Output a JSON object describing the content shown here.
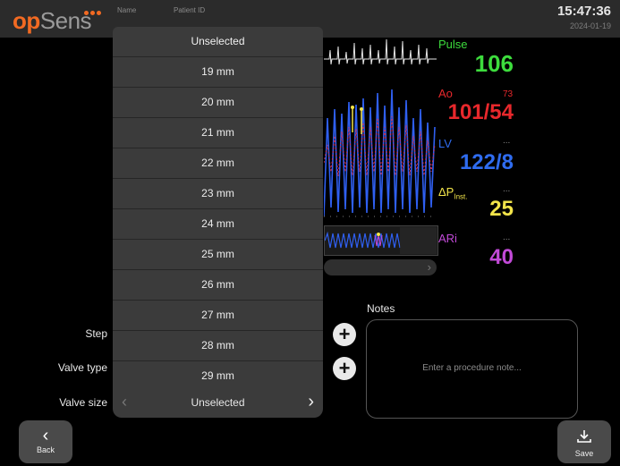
{
  "header": {
    "logo_op": "op",
    "logo_sens": "Sens",
    "name_label": "Name",
    "patient_id_label": "Patient ID",
    "time": "15:47:36",
    "date": "2024-01-19"
  },
  "vitals": {
    "pulse": {
      "label": "Pulse",
      "value": "106",
      "color": "#3ddc3d"
    },
    "ao": {
      "label": "Ao",
      "small": "73",
      "value": "101/54",
      "color": "#e8282c"
    },
    "lv": {
      "label": "LV",
      "small": "...",
      "value": "122/8",
      "color": "#2f6cf0"
    },
    "dp": {
      "label": "ΔP",
      "sub": "Inst.",
      "small": "...",
      "value": "25",
      "color": "#f2e44a"
    },
    "ari": {
      "label": "ARi",
      "small": "...",
      "value": "40",
      "color": "#c24ad8"
    }
  },
  "dropdown": {
    "items": [
      "Unselected",
      "19 mm",
      "20 mm",
      "21 mm",
      "22 mm",
      "23 mm",
      "24 mm",
      "25 mm",
      "26 mm",
      "27 mm",
      "28 mm",
      "29 mm"
    ]
  },
  "form": {
    "step_label": "Step",
    "valve_type_label": "Valve type",
    "valve_size_label": "Valve size",
    "valve_size_value": "Unselected",
    "plus_symbol": "+"
  },
  "notes": {
    "label": "Notes",
    "placeholder": "Enter a procedure note..."
  },
  "buttons": {
    "back": "Back",
    "save": "Save"
  },
  "icons": [
    "back-chevron-icon",
    "save-download-icon",
    "plus-icon",
    "chevron-left-icon",
    "chevron-right-icon"
  ]
}
